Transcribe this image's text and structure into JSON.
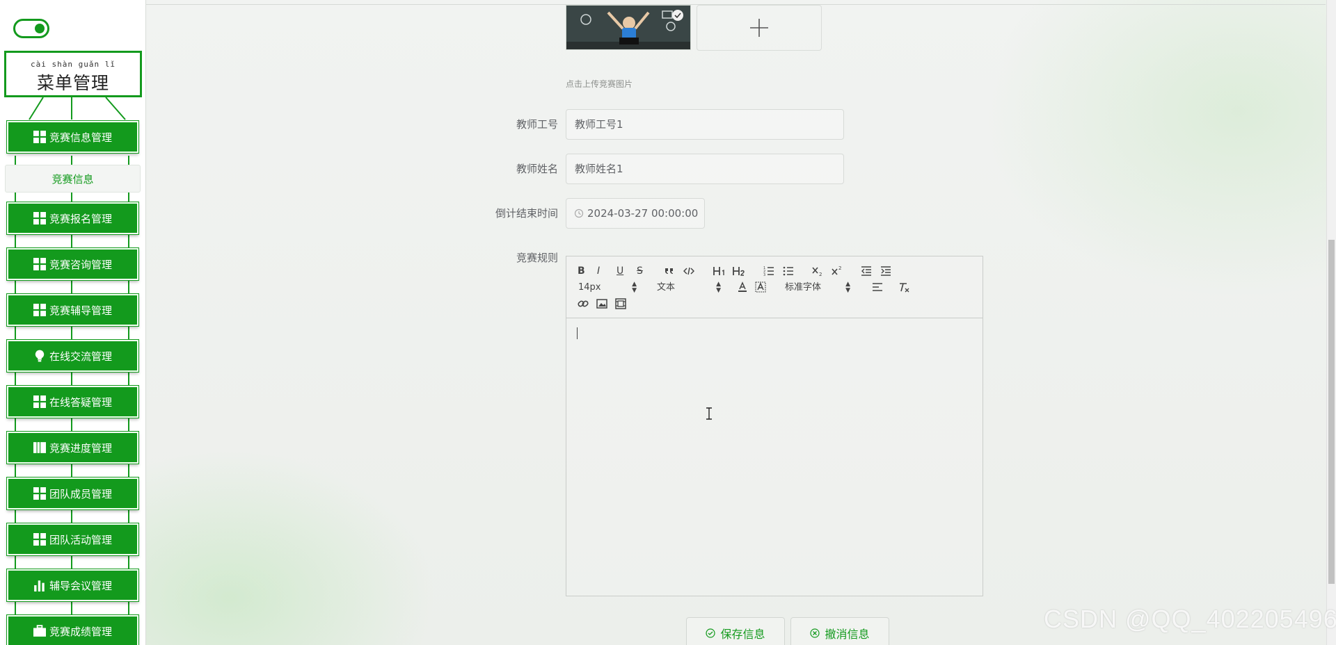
{
  "sidebar": {
    "menu_title_pinyin": "cài shàn guǎn lǐ",
    "menu_title": "菜单管理",
    "active_sub_item": "竞赛信息",
    "items": [
      {
        "label": "竞赛信息管理",
        "icon": "grid-icon"
      },
      {
        "label": "竞赛报名管理",
        "icon": "grid-icon"
      },
      {
        "label": "竞赛咨询管理",
        "icon": "grid-icon"
      },
      {
        "label": "竞赛辅导管理",
        "icon": "grid-icon"
      },
      {
        "label": "在线交流管理",
        "icon": "bulb-icon"
      },
      {
        "label": "在线答疑管理",
        "icon": "grid-icon"
      },
      {
        "label": "竞赛进度管理",
        "icon": "book-icon"
      },
      {
        "label": "团队成员管理",
        "icon": "grid-icon"
      },
      {
        "label": "团队活动管理",
        "icon": "grid-icon"
      },
      {
        "label": "辅导会议管理",
        "icon": "bar-chart-icon"
      },
      {
        "label": "竞赛成绩管理",
        "icon": "briefcase-icon"
      }
    ]
  },
  "form": {
    "upload_hint": "点击上传竞赛图片",
    "teacher_id_label": "教师工号",
    "teacher_id_value": "教师工号1",
    "teacher_name_label": "教师姓名",
    "teacher_name_value": "教师姓名1",
    "countdown_label": "倒计结束时间",
    "countdown_value": "2024-03-27 00:00:00",
    "rules_label": "竞赛规则",
    "editor": {
      "font_size": "14px",
      "header_select": "文本",
      "font_family": "标准字体",
      "tools": [
        "B",
        "I",
        "U",
        "S"
      ]
    },
    "save_button": "保存信息",
    "cancel_button": "撤消信息"
  },
  "watermark": "CSDN @QQ_402205496",
  "colors": {
    "primary": "#139a1d",
    "text": "#606266"
  }
}
